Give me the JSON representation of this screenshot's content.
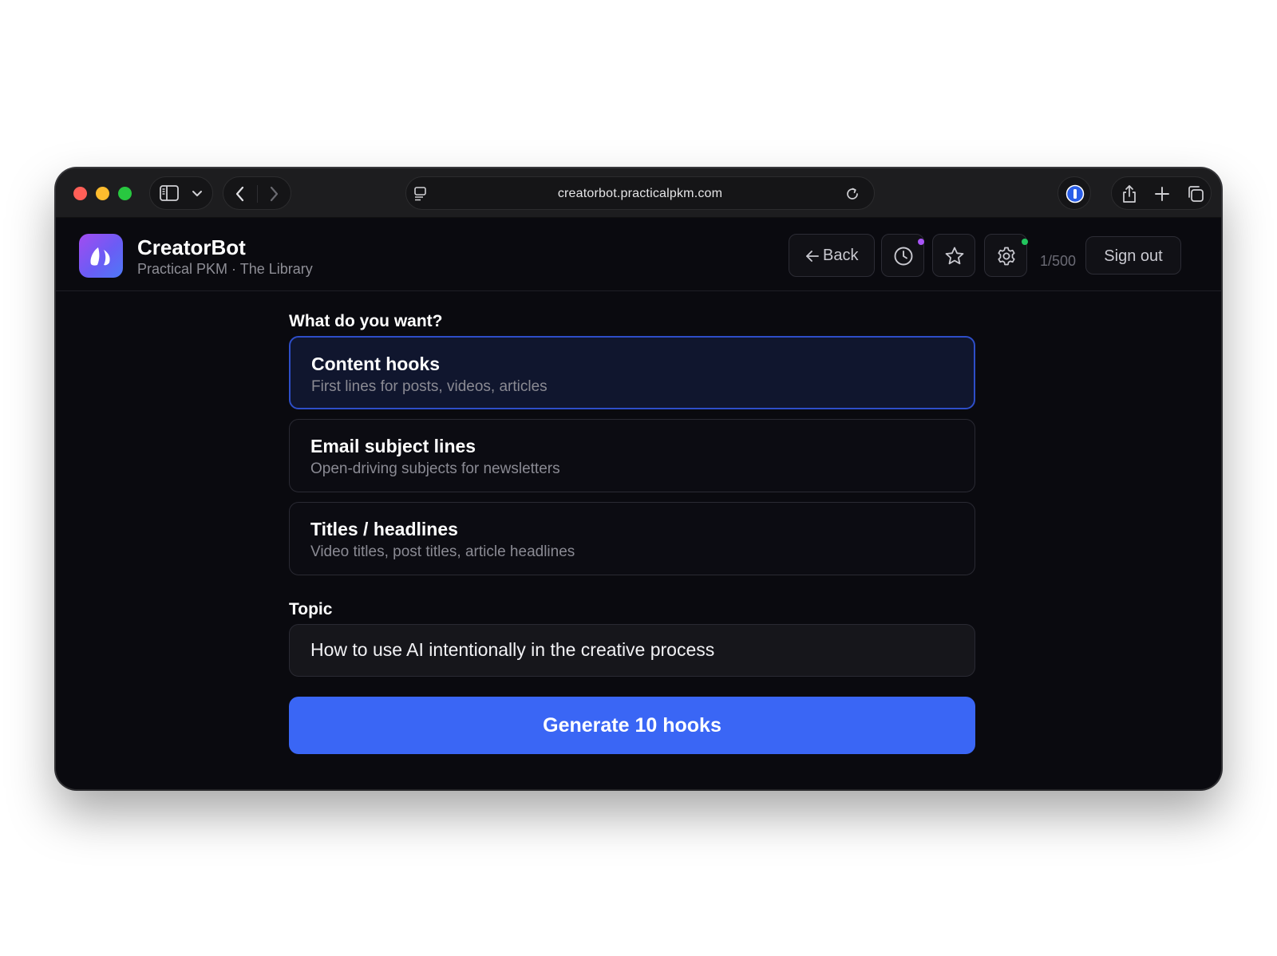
{
  "browser": {
    "url": "creatorbot.practicalpkm.com"
  },
  "app": {
    "title": "CreatorBot",
    "subtitle": "Practical PKM · The Library",
    "back_label": "Back",
    "usage": "1/500",
    "sign_out_label": "Sign out"
  },
  "form": {
    "want_label": "What do you want?",
    "options": [
      {
        "title": "Content hooks",
        "description": "First lines for posts, videos, articles",
        "selected": true
      },
      {
        "title": "Email subject lines",
        "description": "Open-driving subjects for newsletters",
        "selected": false
      },
      {
        "title": "Titles / headlines",
        "description": "Video titles, post titles, article headlines",
        "selected": false
      }
    ],
    "topic_label": "Topic",
    "topic_value": "How to use AI intentionally in the creative process",
    "generate_label": "Generate 10 hooks"
  },
  "colors": {
    "accent": "#3a66f5",
    "selected_border": "#2e4ec8",
    "history_dot": "#a855f7",
    "settings_dot": "#22c55e"
  }
}
